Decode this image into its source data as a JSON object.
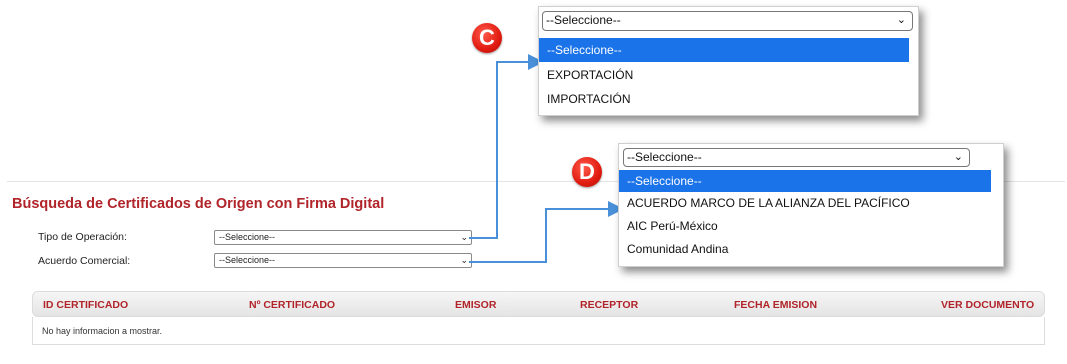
{
  "page": {
    "title": "Búsqueda de Certificados de Origen con Firma Digital"
  },
  "form": {
    "tipo_label": "Tipo de Operación:",
    "tipo_value": "--Seleccione--",
    "acuerdo_label": "Acuerdo Comercial:",
    "acuerdo_value": "--Seleccione--"
  },
  "table": {
    "columns": [
      "ID CERTIFICADO",
      "Nº CERTIFICADO",
      "EMISOR",
      "RECEPTOR",
      "FECHA EMISION",
      "VER DOCUMENTO"
    ],
    "empty_message": "No hay informacion a mostrar."
  },
  "dropdown_c": {
    "badge": "C",
    "selected": "--Seleccione--",
    "options": [
      "--Seleccione--",
      "EXPORTACIÓN",
      "IMPORTACIÓN"
    ]
  },
  "dropdown_d": {
    "badge": "D",
    "selected": "--Seleccione--",
    "options": [
      "--Seleccione--",
      "ACUERDO MARCO DE LA ALIANZA DEL PACÍFICO",
      "AIC Perú-México",
      "Comunidad Andina"
    ]
  },
  "colors": {
    "accent": "#b0242a",
    "highlight": "#1a73e8",
    "connector": "#4a90d9",
    "badge": "#e01b10"
  }
}
